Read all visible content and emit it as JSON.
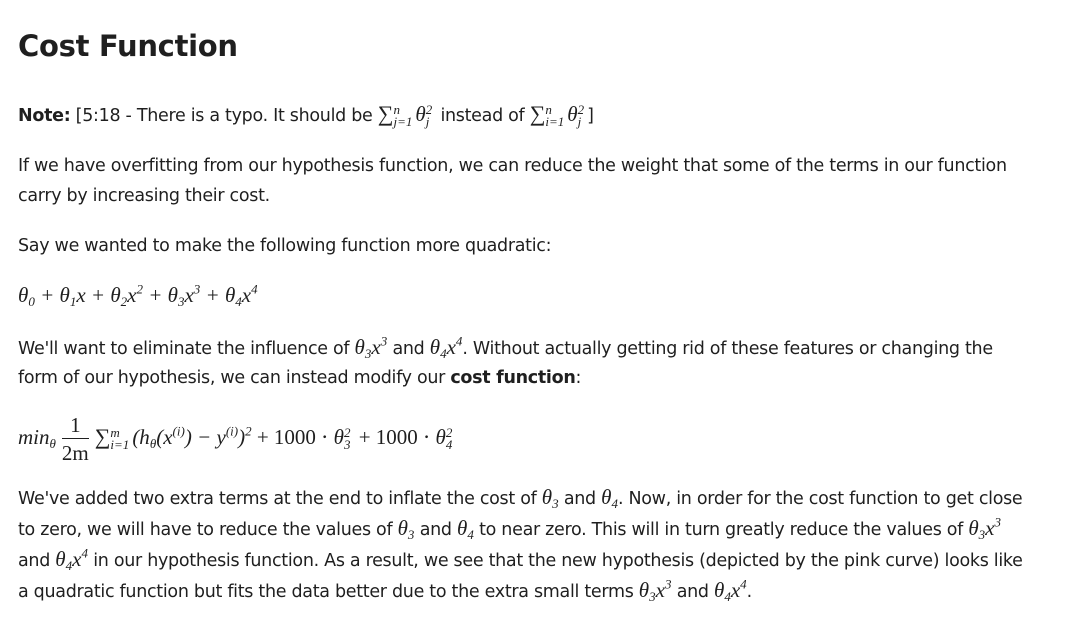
{
  "page": {
    "title": "Cost Function"
  },
  "note": {
    "label": "Note:",
    "text_before": "[5:18 - There is a typo. It should be",
    "text_mid": "instead of",
    "text_end": "]"
  },
  "para1": {
    "line1": "If we have overfitting from our hypothesis function, we can reduce the weight that some of the terms in our function",
    "line2": "carry by increasing their cost."
  },
  "para2": {
    "text": "Say we wanted to make the following function more quadratic:"
  },
  "para3": {
    "line1_a": "We'll want to eliminate the influence of",
    "line1_b": "and",
    "line1_c": ". Without actually getting rid of these features or changing the",
    "line2_a": "form of our hypothesis, we can instead modify our",
    "line2_bold": "cost function",
    "line2_c": ":"
  },
  "para4": {
    "line1_a": "We've added two extra terms at the end to inflate the cost of",
    "line1_b": "and",
    "line1_c": ". Now, in order for the cost function to get close",
    "line2_a": "to zero, we will have to reduce the values of",
    "line2_b": "and",
    "line2_c": "to near zero. This will in turn greatly reduce the values of",
    "line3_a": "and",
    "line3_b": "in our hypothesis function. As a result, we see that the new hypothesis (depicted by the pink curve) looks like",
    "line4_a": "a quadratic function but fits the data better due to the extra small terms",
    "line4_b": "and",
    "line4_c": "."
  }
}
